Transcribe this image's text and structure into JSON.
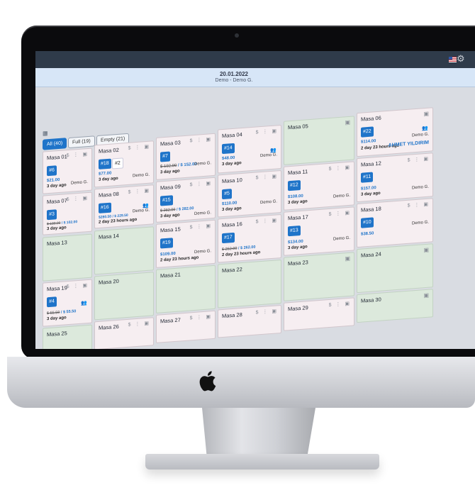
{
  "header": {
    "date": "20.01.2022",
    "user": "Demo - Demo G."
  },
  "filters": [
    {
      "label": "All (40)",
      "active": true
    },
    {
      "label": "Full (19)",
      "active": false
    },
    {
      "label": "Empty (21)",
      "active": false
    }
  ],
  "tables": {
    "t01": {
      "name": "Masa 01",
      "badge": "#6",
      "price": "$21.00",
      "ago": "3 day ago",
      "owner": "Demo G."
    },
    "t02": {
      "name": "Masa 02",
      "badge": "#18",
      "badge2": "#2",
      "price": "$77.00",
      "ago": "3 day ago",
      "owner": "Demo G."
    },
    "t03": {
      "name": "Masa 03",
      "badge": "#7",
      "price_old": "$ 192.00",
      "price": "/ $ 152.00",
      "ago": "3 day ago",
      "owner": "Demo G."
    },
    "t04": {
      "name": "Masa 04",
      "badge": "#14",
      "price": "$48.00",
      "ago": "3 day ago",
      "owner": "Demo G."
    },
    "t05": {
      "name": "Masa 05"
    },
    "t06": {
      "name": "Masa 06",
      "badge": "#22",
      "price": "$114.00",
      "ago": "2 day 23 hours ago",
      "owner": "Demo G.",
      "waiter": "AHMET YILDIRIM"
    },
    "t07": {
      "name": "Masa 07",
      "badge": "#3",
      "price_old": "$ 180.00",
      "price": "/ $ 102.00",
      "ago": "3 day ago",
      "owner": "Demo G."
    },
    "t08": {
      "name": "Masa 08",
      "badge": "#16",
      "price": "$280.50 / $ 229.50",
      "ago": "2 day 23 hours ago",
      "owner": "Demo G."
    },
    "t09": {
      "name": "Masa 09",
      "badge": "#15",
      "price_old": "$ 282.00",
      "price": "/ $ 282.00",
      "ago": "3 day ago",
      "owner": "Demo G."
    },
    "t10": {
      "name": "Masa 10",
      "badge": "#5",
      "price": "$110.00",
      "ago": "3 day ago",
      "owner": "Demo G."
    },
    "t11": {
      "name": "Masa 11",
      "badge": "#12",
      "price": "$108.00",
      "ago": "3 day ago",
      "owner": "Demo G."
    },
    "t12": {
      "name": "Masa 12",
      "badge": "#11",
      "price": "$157.00",
      "ago": "3 day ago",
      "owner": "Demo G."
    },
    "t13": {
      "name": "Masa 13"
    },
    "t14": {
      "name": "Masa 14"
    },
    "t15": {
      "name": "Masa 15",
      "badge": "#19",
      "price": "$109.00",
      "ago": "2 day 23 hours ago",
      "owner": "Demo G."
    },
    "t16": {
      "name": "Masa 16",
      "badge": "#17",
      "price_old": "$ 262.00",
      "price": "/ $ 262.00",
      "ago": "2 day 23 hours ago",
      "owner": "Demo G."
    },
    "t17": {
      "name": "Masa 17",
      "badge": "#13",
      "price": "$134.00",
      "ago": "3 day ago",
      "owner": "Demo G."
    },
    "t18": {
      "name": "Masa 18",
      "badge": "#10",
      "price": "$38.50",
      "ago": "3 day ago",
      "owner": "Demo G."
    },
    "t19": {
      "name": "Masa 19",
      "badge": "#4",
      "price_old": "$ 55.50",
      "price": "/ $ 55.50",
      "ago": "3 day ago",
      "owner": "Demo G."
    },
    "t20": {
      "name": "Masa 20"
    },
    "t21": {
      "name": "Masa 21"
    },
    "t22": {
      "name": "Masa 22"
    },
    "t23": {
      "name": "Masa 23"
    },
    "t24": {
      "name": "Masa 24"
    },
    "t25": {
      "name": "Masa 25"
    },
    "t26": {
      "name": "Masa 26"
    },
    "t27": {
      "name": "Masa 27"
    },
    "t28": {
      "name": "Masa 28"
    },
    "t29": {
      "name": "Masa 29"
    },
    "t30": {
      "name": "Masa 30"
    }
  },
  "icons": {
    "card_actions": "$ ⋮ ▣",
    "note": "▣"
  }
}
